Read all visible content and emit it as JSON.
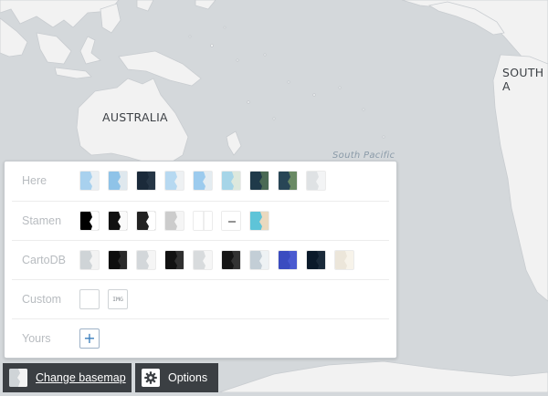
{
  "map": {
    "labels": {
      "australia": "AUSTRALIA",
      "south_america": "SOUTH A",
      "south_pacific": "South Pacific"
    },
    "colors": {
      "water": "#d4d8db",
      "land": "#f2f2f2",
      "border": "#c8ccd0"
    }
  },
  "basemap_panel": {
    "rows": [
      {
        "label": "Here",
        "thumbnails": [
          "here-normal",
          "here-normal-alt",
          "here-night",
          "here-reduced",
          "here-pedestrian",
          "here-terrain",
          "here-satellite",
          "here-hybrid",
          "here-grey"
        ]
      },
      {
        "label": "Stamen",
        "thumbnails": [
          "stamen-toner",
          "stamen-toner-lines",
          "stamen-toner-lite",
          "stamen-toner-background",
          "stamen-toner-hybrid",
          "stamen-toner-labels",
          "stamen-watercolor"
        ]
      },
      {
        "label": "CartoDB",
        "thumbnails": [
          "positron",
          "dark-matter",
          "positron-nolabels",
          "dark-matter-nolabels",
          "positron-lite",
          "dark-matter-lite",
          "flat-blue",
          "midnight",
          "antique"
        ]
      },
      {
        "label": "Custom",
        "img_label": "IMG"
      },
      {
        "label": "Yours",
        "add_label": "+"
      }
    ]
  },
  "bottom_bar": {
    "change_basemap": "Change basemap",
    "options": "Options"
  }
}
